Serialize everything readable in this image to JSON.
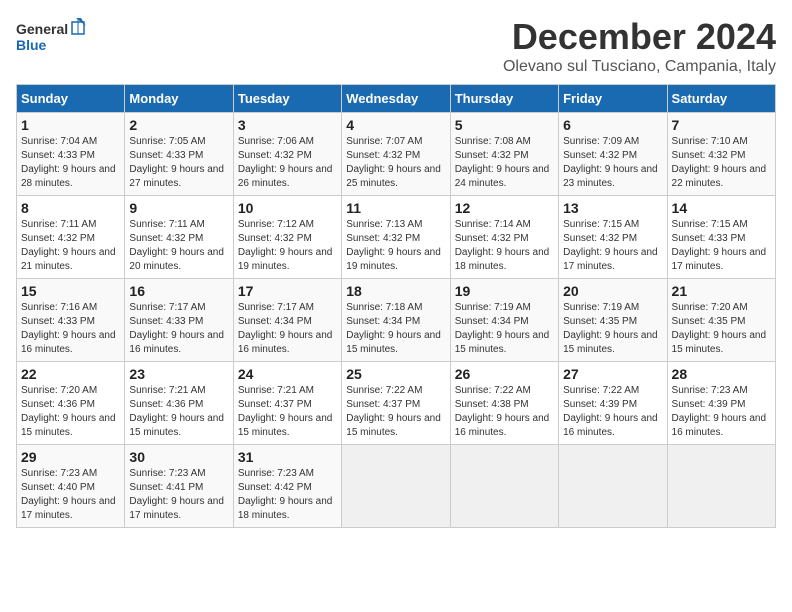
{
  "header": {
    "logo_line1": "General",
    "logo_line2": "Blue",
    "month": "December 2024",
    "location": "Olevano sul Tusciano, Campania, Italy"
  },
  "weekdays": [
    "Sunday",
    "Monday",
    "Tuesday",
    "Wednesday",
    "Thursday",
    "Friday",
    "Saturday"
  ],
  "weeks": [
    [
      {
        "day": "1",
        "sunrise": "Sunrise: 7:04 AM",
        "sunset": "Sunset: 4:33 PM",
        "daylight": "Daylight: 9 hours and 28 minutes."
      },
      {
        "day": "2",
        "sunrise": "Sunrise: 7:05 AM",
        "sunset": "Sunset: 4:33 PM",
        "daylight": "Daylight: 9 hours and 27 minutes."
      },
      {
        "day": "3",
        "sunrise": "Sunrise: 7:06 AM",
        "sunset": "Sunset: 4:32 PM",
        "daylight": "Daylight: 9 hours and 26 minutes."
      },
      {
        "day": "4",
        "sunrise": "Sunrise: 7:07 AM",
        "sunset": "Sunset: 4:32 PM",
        "daylight": "Daylight: 9 hours and 25 minutes."
      },
      {
        "day": "5",
        "sunrise": "Sunrise: 7:08 AM",
        "sunset": "Sunset: 4:32 PM",
        "daylight": "Daylight: 9 hours and 24 minutes."
      },
      {
        "day": "6",
        "sunrise": "Sunrise: 7:09 AM",
        "sunset": "Sunset: 4:32 PM",
        "daylight": "Daylight: 9 hours and 23 minutes."
      },
      {
        "day": "7",
        "sunrise": "Sunrise: 7:10 AM",
        "sunset": "Sunset: 4:32 PM",
        "daylight": "Daylight: 9 hours and 22 minutes."
      }
    ],
    [
      {
        "day": "8",
        "sunrise": "Sunrise: 7:11 AM",
        "sunset": "Sunset: 4:32 PM",
        "daylight": "Daylight: 9 hours and 21 minutes."
      },
      {
        "day": "9",
        "sunrise": "Sunrise: 7:11 AM",
        "sunset": "Sunset: 4:32 PM",
        "daylight": "Daylight: 9 hours and 20 minutes."
      },
      {
        "day": "10",
        "sunrise": "Sunrise: 7:12 AM",
        "sunset": "Sunset: 4:32 PM",
        "daylight": "Daylight: 9 hours and 19 minutes."
      },
      {
        "day": "11",
        "sunrise": "Sunrise: 7:13 AM",
        "sunset": "Sunset: 4:32 PM",
        "daylight": "Daylight: 9 hours and 19 minutes."
      },
      {
        "day": "12",
        "sunrise": "Sunrise: 7:14 AM",
        "sunset": "Sunset: 4:32 PM",
        "daylight": "Daylight: 9 hours and 18 minutes."
      },
      {
        "day": "13",
        "sunrise": "Sunrise: 7:15 AM",
        "sunset": "Sunset: 4:32 PM",
        "daylight": "Daylight: 9 hours and 17 minutes."
      },
      {
        "day": "14",
        "sunrise": "Sunrise: 7:15 AM",
        "sunset": "Sunset: 4:33 PM",
        "daylight": "Daylight: 9 hours and 17 minutes."
      }
    ],
    [
      {
        "day": "15",
        "sunrise": "Sunrise: 7:16 AM",
        "sunset": "Sunset: 4:33 PM",
        "daylight": "Daylight: 9 hours and 16 minutes."
      },
      {
        "day": "16",
        "sunrise": "Sunrise: 7:17 AM",
        "sunset": "Sunset: 4:33 PM",
        "daylight": "Daylight: 9 hours and 16 minutes."
      },
      {
        "day": "17",
        "sunrise": "Sunrise: 7:17 AM",
        "sunset": "Sunset: 4:34 PM",
        "daylight": "Daylight: 9 hours and 16 minutes."
      },
      {
        "day": "18",
        "sunrise": "Sunrise: 7:18 AM",
        "sunset": "Sunset: 4:34 PM",
        "daylight": "Daylight: 9 hours and 15 minutes."
      },
      {
        "day": "19",
        "sunrise": "Sunrise: 7:19 AM",
        "sunset": "Sunset: 4:34 PM",
        "daylight": "Daylight: 9 hours and 15 minutes."
      },
      {
        "day": "20",
        "sunrise": "Sunrise: 7:19 AM",
        "sunset": "Sunset: 4:35 PM",
        "daylight": "Daylight: 9 hours and 15 minutes."
      },
      {
        "day": "21",
        "sunrise": "Sunrise: 7:20 AM",
        "sunset": "Sunset: 4:35 PM",
        "daylight": "Daylight: 9 hours and 15 minutes."
      }
    ],
    [
      {
        "day": "22",
        "sunrise": "Sunrise: 7:20 AM",
        "sunset": "Sunset: 4:36 PM",
        "daylight": "Daylight: 9 hours and 15 minutes."
      },
      {
        "day": "23",
        "sunrise": "Sunrise: 7:21 AM",
        "sunset": "Sunset: 4:36 PM",
        "daylight": "Daylight: 9 hours and 15 minutes."
      },
      {
        "day": "24",
        "sunrise": "Sunrise: 7:21 AM",
        "sunset": "Sunset: 4:37 PM",
        "daylight": "Daylight: 9 hours and 15 minutes."
      },
      {
        "day": "25",
        "sunrise": "Sunrise: 7:22 AM",
        "sunset": "Sunset: 4:37 PM",
        "daylight": "Daylight: 9 hours and 15 minutes."
      },
      {
        "day": "26",
        "sunrise": "Sunrise: 7:22 AM",
        "sunset": "Sunset: 4:38 PM",
        "daylight": "Daylight: 9 hours and 16 minutes."
      },
      {
        "day": "27",
        "sunrise": "Sunrise: 7:22 AM",
        "sunset": "Sunset: 4:39 PM",
        "daylight": "Daylight: 9 hours and 16 minutes."
      },
      {
        "day": "28",
        "sunrise": "Sunrise: 7:23 AM",
        "sunset": "Sunset: 4:39 PM",
        "daylight": "Daylight: 9 hours and 16 minutes."
      }
    ],
    [
      {
        "day": "29",
        "sunrise": "Sunrise: 7:23 AM",
        "sunset": "Sunset: 4:40 PM",
        "daylight": "Daylight: 9 hours and 17 minutes."
      },
      {
        "day": "30",
        "sunrise": "Sunrise: 7:23 AM",
        "sunset": "Sunset: 4:41 PM",
        "daylight": "Daylight: 9 hours and 17 minutes."
      },
      {
        "day": "31",
        "sunrise": "Sunrise: 7:23 AM",
        "sunset": "Sunset: 4:42 PM",
        "daylight": "Daylight: 9 hours and 18 minutes."
      },
      null,
      null,
      null,
      null
    ]
  ]
}
